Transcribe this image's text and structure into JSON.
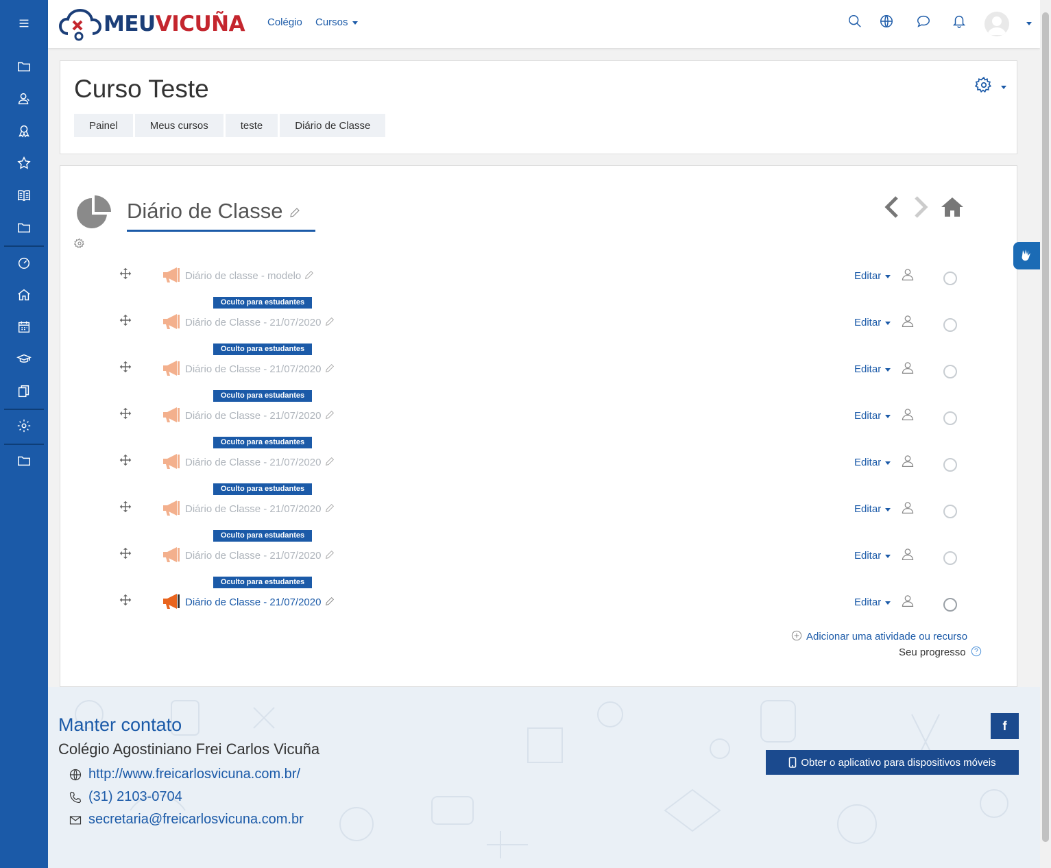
{
  "app": {
    "logo_part1": "MEU",
    "logo_part2": "VICUÑA"
  },
  "navbar": {
    "link_colegio": "Colégio",
    "link_cursos": "Cursos"
  },
  "header": {
    "course_title": "Curso Teste",
    "breadcrumb": [
      "Painel",
      "Meus cursos",
      "teste",
      "Diário de Classe"
    ]
  },
  "section": {
    "title": "Diário de Classe"
  },
  "activities": [
    {
      "name": "Diário de classe - modelo",
      "edit_label": "Editar",
      "hidden_badge": ""
    },
    {
      "name": "Diário de Classe - 21/07/2020",
      "edit_label": "Editar",
      "hidden_badge": "Oculto para estudantes"
    },
    {
      "name": "Diário de Classe - 21/07/2020",
      "edit_label": "Editar",
      "hidden_badge": "Oculto para estudantes"
    },
    {
      "name": "Diário de Classe - 21/07/2020",
      "edit_label": "Editar",
      "hidden_badge": "Oculto para estudantes"
    },
    {
      "name": "Diário de Classe - 21/07/2020",
      "edit_label": "Editar",
      "hidden_badge": "Oculto para estudantes"
    },
    {
      "name": "Diário de Classe - 21/07/2020",
      "edit_label": "Editar",
      "hidden_badge": "Oculto para estudantes"
    },
    {
      "name": "Diário de Classe - 21/07/2020",
      "edit_label": "Editar",
      "hidden_badge": "Oculto para estudantes"
    },
    {
      "name": "Diário de Classe - 21/07/2020",
      "edit_label": "Editar",
      "hidden_badge": "Oculto para estudantes"
    }
  ],
  "section_footer": {
    "add_activity": "Adicionar uma atividade ou recurso",
    "progress": "Seu progresso"
  },
  "footer": {
    "title": "Manter contato",
    "school": "Colégio Agostiniano Frei Carlos Vicuña",
    "website": "http://www.freicarlosvicuna.com.br/",
    "phone": "(31) 2103-0704",
    "email": "secretaria@freicarlosvicuna.com.br",
    "facebook": "f",
    "app_button": "Obter o aplicativo para dispositivos móveis"
  },
  "colors": {
    "primary": "#1b5aa8",
    "sidebar": "#1b5aa8",
    "badge": "#1b5aa8",
    "logo_blue": "#1b3e78",
    "logo_red": "#c4262e",
    "megaphone": "#e8641e"
  },
  "icons": {
    "sidebar": [
      "menu-icon",
      "folder-icon",
      "users-icon",
      "badge-icon",
      "star-icon",
      "book-icon",
      "folder-icon",
      "dashboard-icon",
      "home-icon",
      "calendar-icon",
      "graduation-cap-icon",
      "files-icon",
      "gear-icon",
      "folder-icon"
    ],
    "navbar": [
      "search-icon",
      "globe-icon",
      "chat-icon",
      "bell-icon"
    ]
  }
}
